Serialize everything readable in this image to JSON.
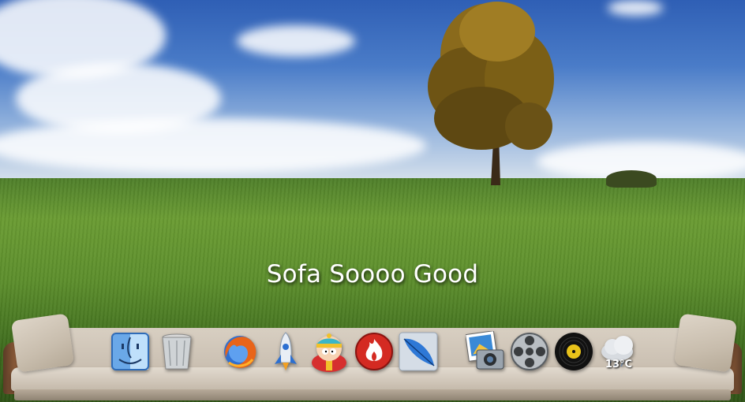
{
  "wallpaper": {
    "title_text": "Sofa Soooo Good"
  },
  "dock": {
    "items": [
      {
        "name": "finder",
        "icon": "finder-icon"
      },
      {
        "name": "trash",
        "icon": "trash-icon"
      },
      {
        "name": "firefox",
        "icon": "firefox-icon"
      },
      {
        "name": "rocket",
        "icon": "rocket-icon"
      },
      {
        "name": "cartman",
        "icon": "cartman-icon"
      },
      {
        "name": "flame",
        "icon": "flame-icon"
      },
      {
        "name": "feather",
        "icon": "feather-icon"
      },
      {
        "name": "photo",
        "icon": "photo-camera-icon"
      },
      {
        "name": "film-reel",
        "icon": "film-reel-icon"
      },
      {
        "name": "vinyl",
        "icon": "vinyl-record-icon"
      },
      {
        "name": "weather",
        "icon": "weather-cloud-icon"
      }
    ],
    "weather": {
      "temperature": "13°C"
    }
  },
  "colors": {
    "sofa_fabric": "#d8cfc2",
    "sofa_wood": "#8a5a38",
    "sky": "#2f5fb5",
    "grass": "#5d8f2c"
  }
}
